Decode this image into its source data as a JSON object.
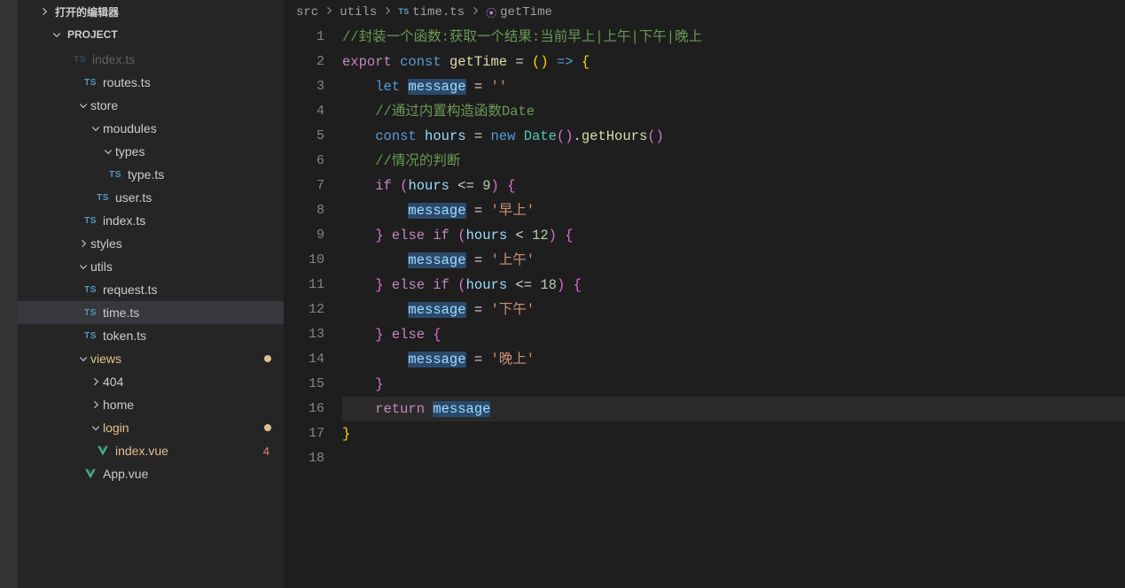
{
  "sidebar": {
    "open_editors_header": "打开的编辑器",
    "project_header": "PROJECT",
    "tree": [
      {
        "label": "index.ts",
        "kind": "file",
        "icon": "ts",
        "indent": 60,
        "dim": true
      },
      {
        "label": "routes.ts",
        "kind": "file",
        "icon": "ts",
        "indent": 72
      },
      {
        "label": "store",
        "kind": "folder",
        "open": true,
        "indent": 66
      },
      {
        "label": "moudules",
        "kind": "folder",
        "open": true,
        "indent": 80
      },
      {
        "label": "types",
        "kind": "folder",
        "open": true,
        "indent": 94
      },
      {
        "label": "type.ts",
        "kind": "file",
        "icon": "ts",
        "indent": 100
      },
      {
        "label": "user.ts",
        "kind": "file",
        "icon": "ts",
        "indent": 86
      },
      {
        "label": "index.ts",
        "kind": "file",
        "icon": "ts",
        "indent": 72
      },
      {
        "label": "styles",
        "kind": "folder",
        "open": false,
        "indent": 66
      },
      {
        "label": "utils",
        "kind": "folder",
        "open": true,
        "indent": 66
      },
      {
        "label": "request.ts",
        "kind": "file",
        "icon": "ts",
        "indent": 72
      },
      {
        "label": "time.ts",
        "kind": "file",
        "icon": "ts",
        "indent": 72,
        "selected": true
      },
      {
        "label": "token.ts",
        "kind": "file",
        "icon": "ts",
        "indent": 72
      },
      {
        "label": "views",
        "kind": "folder",
        "open": true,
        "indent": 66,
        "gitmod": true,
        "dot": true
      },
      {
        "label": "404",
        "kind": "folder",
        "open": false,
        "indent": 80
      },
      {
        "label": "home",
        "kind": "folder",
        "open": false,
        "indent": 80
      },
      {
        "label": "login",
        "kind": "folder",
        "open": true,
        "indent": 80,
        "gitmod": true,
        "dot": true
      },
      {
        "label": "index.vue",
        "kind": "file",
        "icon": "vue",
        "indent": 86,
        "gitmod": true,
        "deco": "4"
      },
      {
        "label": "App.vue",
        "kind": "file",
        "icon": "vue",
        "indent": 72
      }
    ]
  },
  "breadcrumbs": {
    "items": [
      {
        "label": "src",
        "icon": ""
      },
      {
        "label": "utils",
        "icon": ""
      },
      {
        "label": "time.ts",
        "icon": "ts"
      },
      {
        "label": "getTime",
        "icon": "fn"
      }
    ]
  },
  "code": {
    "total_lines": 18,
    "lines": [
      [
        {
          "c": "tk-comment",
          "t": "//封装一个函数:获取一个结果:当前早上|上午|下午|晚上"
        }
      ],
      [
        {
          "c": "tk-keyword",
          "t": "export"
        },
        {
          "c": "tk-punc",
          "t": " "
        },
        {
          "c": "tk-keyword2",
          "t": "const"
        },
        {
          "c": "tk-punc",
          "t": " "
        },
        {
          "c": "tk-fn",
          "t": "getTime"
        },
        {
          "c": "tk-punc",
          "t": " "
        },
        {
          "c": "tk-punc",
          "t": "="
        },
        {
          "c": "tk-punc",
          "t": " "
        },
        {
          "c": "tk-brace-y",
          "t": "("
        },
        {
          "c": "tk-brace-y",
          "t": ")"
        },
        {
          "c": "tk-punc",
          "t": " "
        },
        {
          "c": "tk-keyword2",
          "t": "=>"
        },
        {
          "c": "tk-punc",
          "t": " "
        },
        {
          "c": "tk-brace-y",
          "t": "{"
        }
      ],
      [
        {
          "c": "tk-punc",
          "t": "    "
        },
        {
          "c": "tk-keyword2",
          "t": "let"
        },
        {
          "c": "tk-punc",
          "t": " "
        },
        {
          "c": "tk-var-hl",
          "t": "message"
        },
        {
          "c": "tk-punc",
          "t": " = "
        },
        {
          "c": "tk-string",
          "t": "''"
        }
      ],
      [
        {
          "c": "tk-punc",
          "t": "    "
        },
        {
          "c": "tk-comment",
          "t": "//通过内置构造函数Date"
        }
      ],
      [
        {
          "c": "tk-punc",
          "t": "    "
        },
        {
          "c": "tk-keyword2",
          "t": "const"
        },
        {
          "c": "tk-punc",
          "t": " "
        },
        {
          "c": "tk-var",
          "t": "hours"
        },
        {
          "c": "tk-punc",
          "t": " = "
        },
        {
          "c": "tk-keyword2",
          "t": "new"
        },
        {
          "c": "tk-punc",
          "t": " "
        },
        {
          "c": "tk-type",
          "t": "Date"
        },
        {
          "c": "tk-brace-p",
          "t": "()"
        },
        {
          "c": "tk-punc",
          "t": "."
        },
        {
          "c": "tk-fn",
          "t": "getHours"
        },
        {
          "c": "tk-brace-p",
          "t": "()"
        }
      ],
      [
        {
          "c": "tk-punc",
          "t": "    "
        },
        {
          "c": "tk-comment",
          "t": "//情况的判断"
        }
      ],
      [
        {
          "c": "tk-punc",
          "t": "    "
        },
        {
          "c": "tk-keyword",
          "t": "if"
        },
        {
          "c": "tk-punc",
          "t": " "
        },
        {
          "c": "tk-brace-p",
          "t": "("
        },
        {
          "c": "tk-var",
          "t": "hours"
        },
        {
          "c": "tk-punc",
          "t": " <= "
        },
        {
          "c": "tk-num",
          "t": "9"
        },
        {
          "c": "tk-brace-p",
          "t": ")"
        },
        {
          "c": "tk-punc",
          "t": " "
        },
        {
          "c": "tk-brace-p",
          "t": "{"
        }
      ],
      [
        {
          "c": "tk-punc",
          "t": "        "
        },
        {
          "c": "tk-var-hl",
          "t": "message"
        },
        {
          "c": "tk-punc",
          "t": " = "
        },
        {
          "c": "tk-string",
          "t": "'早上'"
        }
      ],
      [
        {
          "c": "tk-punc",
          "t": "    "
        },
        {
          "c": "tk-brace-p",
          "t": "}"
        },
        {
          "c": "tk-punc",
          "t": " "
        },
        {
          "c": "tk-keyword",
          "t": "else"
        },
        {
          "c": "tk-punc",
          "t": " "
        },
        {
          "c": "tk-keyword",
          "t": "if"
        },
        {
          "c": "tk-punc",
          "t": " "
        },
        {
          "c": "tk-brace-p",
          "t": "("
        },
        {
          "c": "tk-var",
          "t": "hours"
        },
        {
          "c": "tk-punc",
          "t": " < "
        },
        {
          "c": "tk-num",
          "t": "12"
        },
        {
          "c": "tk-brace-p",
          "t": ")"
        },
        {
          "c": "tk-punc",
          "t": " "
        },
        {
          "c": "tk-brace-p",
          "t": "{"
        }
      ],
      [
        {
          "c": "tk-punc",
          "t": "        "
        },
        {
          "c": "tk-var-hl",
          "t": "message"
        },
        {
          "c": "tk-punc",
          "t": " = "
        },
        {
          "c": "tk-string",
          "t": "'上午'"
        }
      ],
      [
        {
          "c": "tk-punc",
          "t": "    "
        },
        {
          "c": "tk-brace-p",
          "t": "}"
        },
        {
          "c": "tk-punc",
          "t": " "
        },
        {
          "c": "tk-keyword",
          "t": "else"
        },
        {
          "c": "tk-punc",
          "t": " "
        },
        {
          "c": "tk-keyword",
          "t": "if"
        },
        {
          "c": "tk-punc",
          "t": " "
        },
        {
          "c": "tk-brace-p",
          "t": "("
        },
        {
          "c": "tk-var",
          "t": "hours"
        },
        {
          "c": "tk-punc",
          "t": " <= "
        },
        {
          "c": "tk-num",
          "t": "18"
        },
        {
          "c": "tk-brace-p",
          "t": ")"
        },
        {
          "c": "tk-punc",
          "t": " "
        },
        {
          "c": "tk-brace-p",
          "t": "{"
        }
      ],
      [
        {
          "c": "tk-punc",
          "t": "        "
        },
        {
          "c": "tk-var-hl",
          "t": "message"
        },
        {
          "c": "tk-punc",
          "t": " = "
        },
        {
          "c": "tk-string",
          "t": "'下午'"
        }
      ],
      [
        {
          "c": "tk-punc",
          "t": "    "
        },
        {
          "c": "tk-brace-p",
          "t": "}"
        },
        {
          "c": "tk-punc",
          "t": " "
        },
        {
          "c": "tk-keyword",
          "t": "else"
        },
        {
          "c": "tk-punc",
          "t": " "
        },
        {
          "c": "tk-brace-p",
          "t": "{"
        }
      ],
      [
        {
          "c": "tk-punc",
          "t": "        "
        },
        {
          "c": "tk-var-hl",
          "t": "message"
        },
        {
          "c": "tk-punc",
          "t": " = "
        },
        {
          "c": "tk-string",
          "t": "'晚上'"
        }
      ],
      [
        {
          "c": "tk-punc",
          "t": "    "
        },
        {
          "c": "tk-brace-p",
          "t": "}"
        }
      ],
      [
        {
          "c": "tk-punc",
          "t": "    "
        },
        {
          "c": "tk-keyword",
          "t": "return"
        },
        {
          "c": "tk-punc",
          "t": " "
        },
        {
          "c": "tk-var-hl",
          "t": "message"
        }
      ],
      [
        {
          "c": "tk-brace-y",
          "t": "}"
        }
      ],
      [
        {
          "c": "tk-punc",
          "t": ""
        }
      ]
    ],
    "active_line": 16
  }
}
